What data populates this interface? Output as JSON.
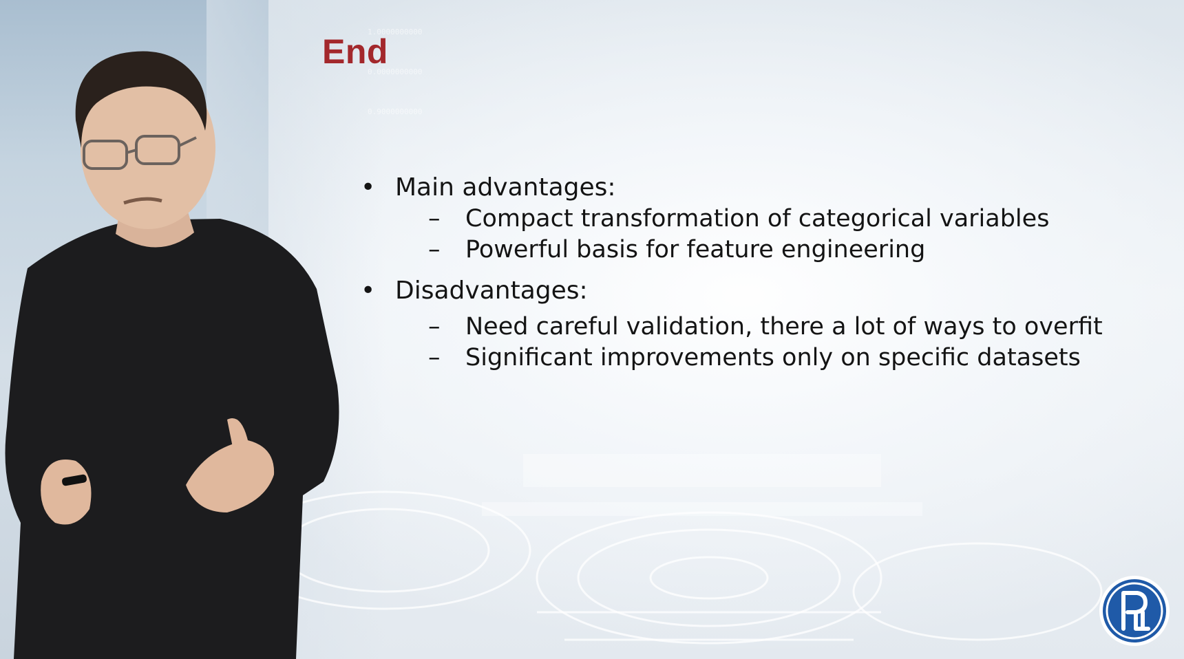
{
  "slide": {
    "title": "End",
    "sections": [
      {
        "bullet_symbol": "•",
        "label": "Main advantages:",
        "items": [
          {
            "dash": "–",
            "text": "Compact transformation of categorical variables"
          },
          {
            "dash": "–",
            "text": "Powerful basis for feature engineering"
          }
        ]
      },
      {
        "bullet_symbol": "•",
        "label": "Disadvantages:",
        "items": [
          {
            "dash": "–",
            "text": "Need careful validation, there a lot of ways to overfit"
          },
          {
            "dash": "–",
            "text": "Significant improvements only on specific datasets"
          }
        ]
      }
    ]
  },
  "colors": {
    "title": "#a3282c",
    "body_text": "#141414",
    "logo_blue": "#1f5aa8",
    "sweater": "#1c1c1e"
  },
  "background_numbers": [
    "1.0000000000",
    "0.9000000000",
    "0.0000000000"
  ],
  "icons": {
    "logo": "university-logo",
    "presenter": "presenter-figure",
    "background": "gear-pattern"
  }
}
